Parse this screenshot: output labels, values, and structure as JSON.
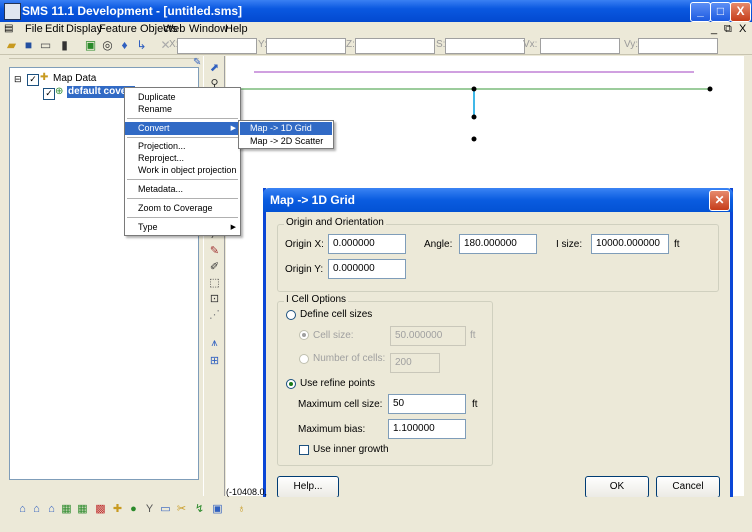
{
  "window": {
    "title": "SMS 11.1 Development - [untitled.sms]",
    "min": "_",
    "max": "□",
    "close": "X"
  },
  "menu": [
    "File",
    "Edit",
    "Display",
    "Feature Objects",
    "Web",
    "Window",
    "Help"
  ],
  "mdi_controls": [
    "_",
    "⧉",
    "X"
  ],
  "coords": [
    {
      "label": "X:",
      "value": ""
    },
    {
      "label": "Y:",
      "value": ""
    },
    {
      "label": "Z:",
      "value": ""
    },
    {
      "label": "S:",
      "value": ""
    },
    {
      "label": "Vx:",
      "value": ""
    },
    {
      "label": "Vy:",
      "value": ""
    }
  ],
  "tree": {
    "root": "Map Data",
    "child": "default coverage"
  },
  "context_menu": {
    "items": [
      "Duplicate",
      "Rename",
      "Convert",
      "Projection...",
      "Reproject...",
      "Work in object projection",
      "Metadata...",
      "Zoom to Coverage",
      "Type"
    ],
    "submenu": [
      "Map -> 1D Grid",
      "Map -> 2D Scatter"
    ]
  },
  "dialog": {
    "title": "Map -> 1D Grid",
    "origin_group": "Origin and Orientation",
    "origin_x_label": "Origin X:",
    "origin_x": "0.000000",
    "origin_y_label": "Origin Y:",
    "origin_y": "0.000000",
    "angle_label": "Angle:",
    "angle": "180.000000",
    "isize_label": "I size:",
    "isize": "10000.000000",
    "unit_ft": "ft",
    "cell_group": "I Cell Options",
    "define_cell_sizes": "Define cell sizes",
    "cell_size_label": "Cell size:",
    "cell_size": "50.000000",
    "num_cells_label": "Number of cells:",
    "num_cells": "200",
    "use_refine": "Use refine points",
    "max_cell_label": "Maximum cell size:",
    "max_cell": "50",
    "max_bias_label": "Maximum bias:",
    "max_bias": "1.100000",
    "inner_growth": "Use inner growth",
    "help": "Help...",
    "ok": "OK",
    "cancel": "Cancel"
  },
  "status": {
    "coord": "(-10408.0,"
  },
  "colors": {
    "titlebar": "#0a58e0",
    "selection": "#316ac5",
    "arc_purple": "#a040c0",
    "arc_green": "#3a9a3a",
    "arc_cyan": "#00a0e0"
  }
}
